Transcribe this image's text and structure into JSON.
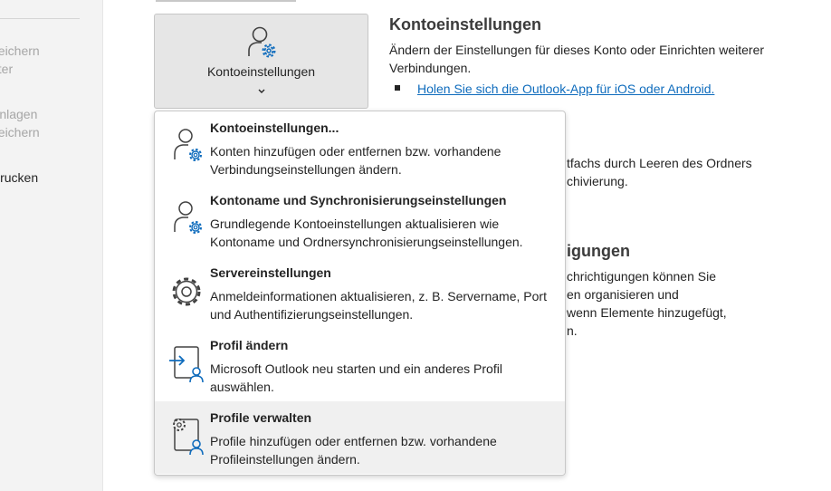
{
  "sidebar": {
    "items": [
      {
        "label": "peichern",
        "active": false
      },
      {
        "label": "nter",
        "active": false
      },
      {
        "label": "Anlagen",
        "active": false
      },
      {
        "label": "peichern",
        "active": false
      },
      {
        "label": "Drucken",
        "active": true
      }
    ]
  },
  "account_button": {
    "label": "Kontoeinstellungen",
    "icon": "person-gear-icon",
    "chevron": "chevron-down-icon"
  },
  "info": {
    "title": "Kontoeinstellungen",
    "text": "Ändern der Einstellungen für dieses Konto oder Einrichten weiterer Verbindungen.",
    "link": "Holen Sie sich die Outlook-App für iOS oder Android."
  },
  "background": {
    "line1": "tfachs durch Leeren des Ordners",
    "line2": "chivierung.",
    "heading": "igungen",
    "line3": "chrichtigungen können Sie",
    "line4": "en organisieren und",
    "line5": "wenn Elemente hinzugefügt,",
    "line6": "n."
  },
  "menu": {
    "items": [
      {
        "title": "Kontoeinstellungen...",
        "desc": "Konten hinzufügen oder entfernen bzw. vorhandene Verbindungseinstellungen ändern.",
        "icon": "person-gear-icon"
      },
      {
        "title": "Kontoname und Synchronisierungseinstellungen",
        "desc": "Grundlegende Kontoeinstellungen aktualisieren wie Kontoname und Ordnersynchronisierungseinstellungen.",
        "icon": "person-gear-icon"
      },
      {
        "title": "Servereinstellungen",
        "desc": "Anmeldeinformationen aktualisieren, z. B. Servername, Port und Authentifizierungseinstellungen.",
        "icon": "gear-icon"
      },
      {
        "title": "Profil ändern",
        "desc": "Microsoft Outlook neu starten und ein anderes Profil auswählen.",
        "icon": "switch-profile-icon"
      },
      {
        "title": "Profile verwalten",
        "desc": "Profile hinzufügen oder entfernen bzw. vorhandene Profileinstellungen ändern.",
        "icon": "manage-profiles-icon"
      }
    ]
  },
  "colors": {
    "accent_blue": "#0f6cbd",
    "icon_gray": "#424242",
    "hover_bg": "#f0f0f0"
  }
}
